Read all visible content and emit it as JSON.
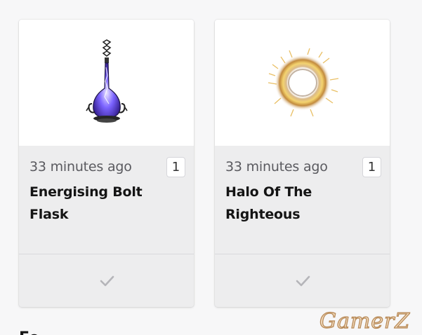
{
  "cards": [
    {
      "time": "33 minutes ago",
      "count": "1",
      "title": "Energising Bolt Flask",
      "image": "flask-icon"
    },
    {
      "time": "33 minutes ago",
      "count": "1",
      "title": "Halo Of The Righteous",
      "image": "halo-icon"
    }
  ],
  "footer_icon": "checkmark-icon",
  "section_heading_partial": "Fe",
  "watermark": "GamerZ"
}
